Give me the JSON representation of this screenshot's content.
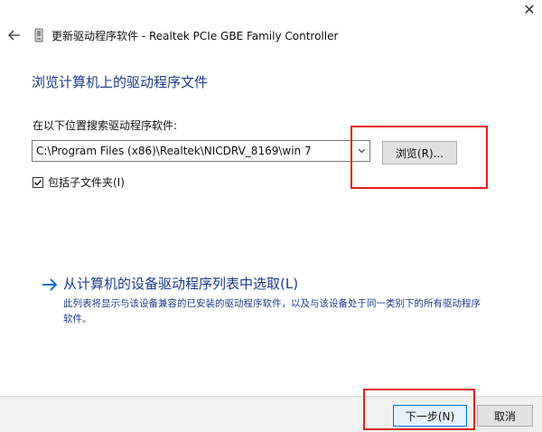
{
  "window": {
    "title": "更新驱动程序软件 - Realtek PCIe GBE Family Controller",
    "close_glyph": "✕"
  },
  "heading": "浏览计算机上的驱动程序文件",
  "search": {
    "label": "在以下位置搜索驱动程序软件:",
    "path_value": "C:\\Program Files (x86)\\Realtek\\NICDRV_8169\\win 7",
    "browse_label": "浏览(R)..."
  },
  "include_subfolders": {
    "label": "包括子文件夹(I)",
    "checked": true
  },
  "pick_from_list": {
    "title": "从计算机的设备驱动程序列表中选取(L)",
    "description": "此列表将显示与该设备兼容的已安装的驱动程序软件，以及与该设备处于同一类别下的所有驱动程序软件。"
  },
  "footer": {
    "next_label": "下一步(N)",
    "cancel_label": "取消"
  },
  "colors": {
    "heading_blue": "#1e3c8c",
    "highlight_red": "#e02020",
    "primary_button_border": "#0078d7"
  },
  "icons": {
    "back": "back-arrow-icon",
    "device": "device-driver-icon",
    "dropdown": "chevron-down-icon",
    "check": "checkmark-icon",
    "link_arrow": "right-arrow-icon"
  }
}
